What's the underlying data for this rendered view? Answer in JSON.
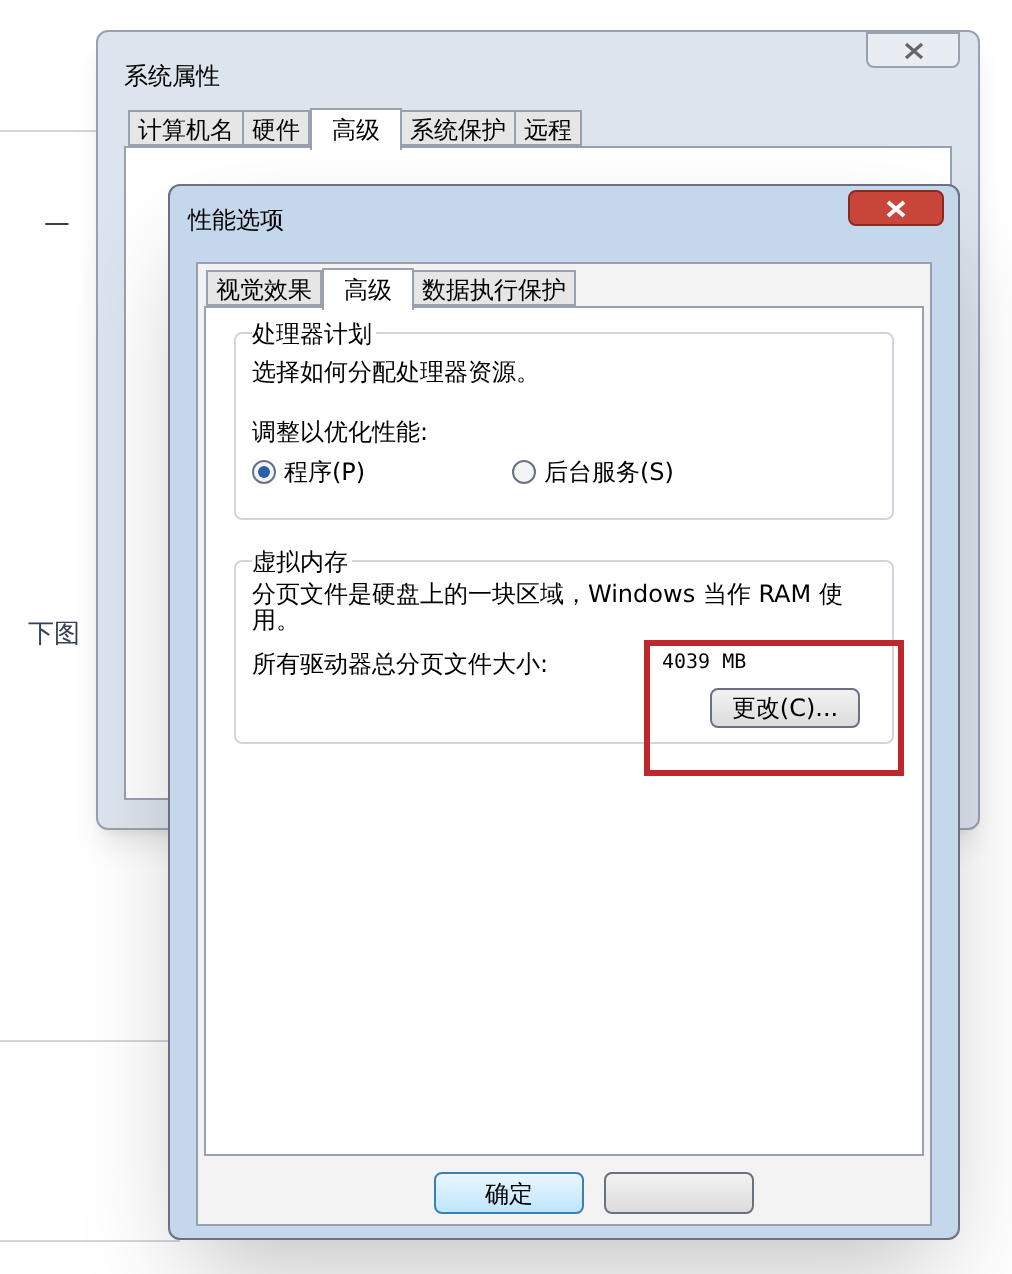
{
  "background": {
    "fragments": [
      "一",
      "下图"
    ]
  },
  "system_properties": {
    "title": "系统属性",
    "tabs": [
      {
        "label": "计算机名",
        "selected": false
      },
      {
        "label": "硬件",
        "selected": false
      },
      {
        "label": "高级",
        "selected": true
      },
      {
        "label": "系统保护",
        "selected": false
      },
      {
        "label": "远程",
        "selected": false
      }
    ]
  },
  "performance_options": {
    "title": "性能选项",
    "tabs": [
      {
        "label": "视觉效果",
        "selected": false
      },
      {
        "label": "高级",
        "selected": true
      },
      {
        "label": "数据执行保护",
        "selected": false
      }
    ],
    "processor_scheduling": {
      "title": "处理器计划",
      "description": "选择如何分配处理器资源。",
      "adjust_label": "调整以优化性能:",
      "options": [
        {
          "label": "程序(P)",
          "selected": true
        },
        {
          "label": "后台服务(S)",
          "selected": false
        }
      ]
    },
    "virtual_memory": {
      "title": "虚拟内存",
      "description": "分页文件是硬盘上的一块区域，Windows 当作 RAM 使用。",
      "total_label": "所有驱动器总分页文件大小:",
      "total_value": "4039 MB",
      "change_button": "更改(C)...",
      "highlighted": true
    },
    "buttons": [
      "确定"
    ]
  }
}
